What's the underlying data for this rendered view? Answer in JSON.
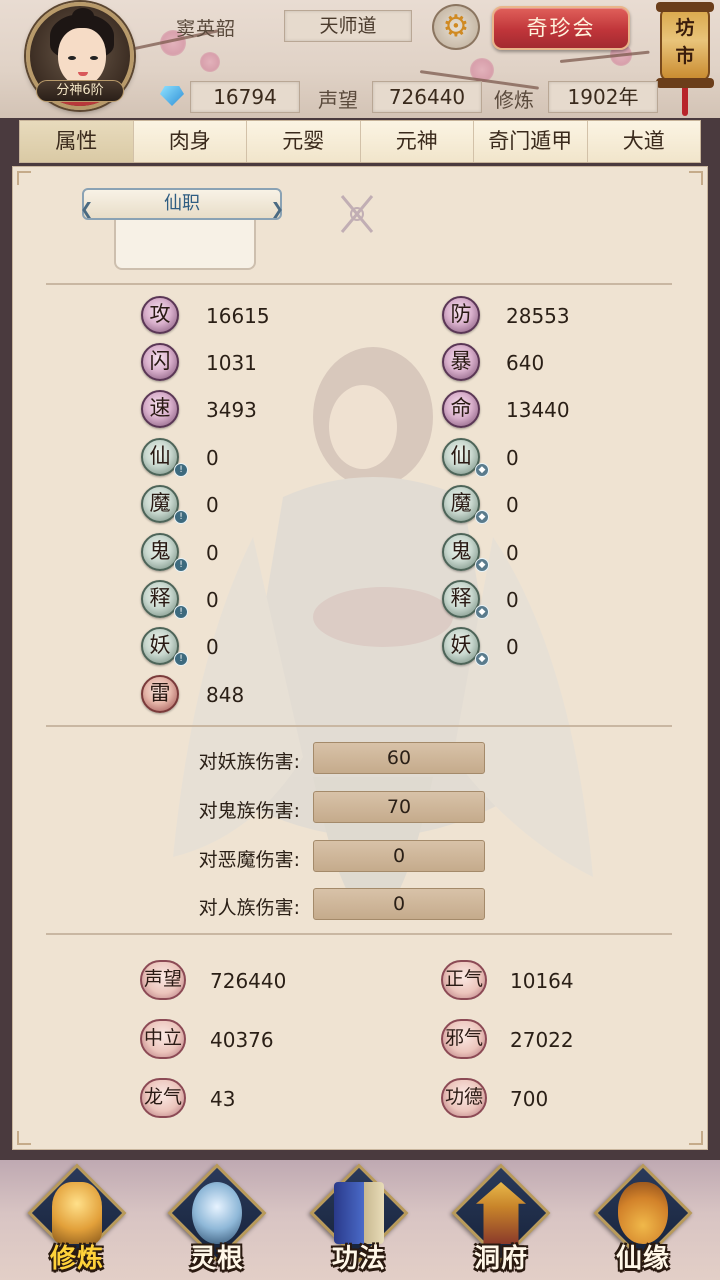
{
  "header": {
    "rank_badge": "分神6阶",
    "player_name": "窦英韶",
    "sect": "天师道",
    "treasure_button": "奇珍会",
    "market_label": "坊市",
    "gems": "16794",
    "reputation_label": "声望",
    "reputation": "726440",
    "cultivation_label": "修炼",
    "cultivation_years": "1902年"
  },
  "tabs": [
    {
      "label": "属性",
      "active": true
    },
    {
      "label": "肉身",
      "active": false
    },
    {
      "label": "元婴",
      "active": false
    },
    {
      "label": "元神",
      "active": false
    },
    {
      "label": "奇门遁甲",
      "active": false
    },
    {
      "label": "大道",
      "active": false
    }
  ],
  "immortal_post": {
    "label": "仙职"
  },
  "attributes": {
    "left": [
      {
        "icon": "攻",
        "value": "16615",
        "style": "purple",
        "badge": ""
      },
      {
        "icon": "闪",
        "value": "1031",
        "style": "purple",
        "badge": ""
      },
      {
        "icon": "速",
        "value": "3493",
        "style": "purple",
        "badge": ""
      },
      {
        "icon": "仙",
        "value": "0",
        "style": "teal",
        "badge": "attack"
      },
      {
        "icon": "魔",
        "value": "0",
        "style": "teal",
        "badge": "attack"
      },
      {
        "icon": "鬼",
        "value": "0",
        "style": "teal",
        "badge": "attack"
      },
      {
        "icon": "释",
        "value": "0",
        "style": "teal",
        "badge": "attack"
      },
      {
        "icon": "妖",
        "value": "0",
        "style": "teal",
        "badge": "attack"
      },
      {
        "icon": "雷",
        "value": "848",
        "style": "red",
        "badge": ""
      }
    ],
    "right": [
      {
        "icon": "防",
        "value": "28553",
        "style": "purple",
        "badge": ""
      },
      {
        "icon": "暴",
        "value": "640",
        "style": "purple",
        "badge": ""
      },
      {
        "icon": "命",
        "value": "13440",
        "style": "purple",
        "badge": ""
      },
      {
        "icon": "仙",
        "value": "0",
        "style": "teal",
        "badge": "defense"
      },
      {
        "icon": "魔",
        "value": "0",
        "style": "teal",
        "badge": "defense"
      },
      {
        "icon": "鬼",
        "value": "0",
        "style": "teal",
        "badge": "defense"
      },
      {
        "icon": "释",
        "value": "0",
        "style": "teal",
        "badge": "defense"
      },
      {
        "icon": "妖",
        "value": "0",
        "style": "teal",
        "badge": "defense"
      }
    ]
  },
  "damage_bonuses": [
    {
      "label": "对妖族伤害:",
      "value": "60"
    },
    {
      "label": "对鬼族伤害:",
      "value": "70"
    },
    {
      "label": "对恶魔伤害:",
      "value": "0"
    },
    {
      "label": "对人族伤害:",
      "value": "0"
    }
  ],
  "standing": {
    "left": [
      {
        "icon": "声望",
        "value": "726440"
      },
      {
        "icon": "中立",
        "value": "40376"
      },
      {
        "icon": "龙气",
        "value": "43"
      }
    ],
    "right": [
      {
        "icon": "正气",
        "value": "10164"
      },
      {
        "icon": "邪气",
        "value": "27022"
      },
      {
        "icon": "功德",
        "value": "700"
      }
    ]
  },
  "bottom_nav": [
    {
      "label": "修炼",
      "icon": "cultivation-icon",
      "active": true
    },
    {
      "label": "灵根",
      "icon": "spirit-root-icon",
      "active": false
    },
    {
      "label": "功法",
      "icon": "technique-book-icon",
      "active": false
    },
    {
      "label": "洞府",
      "icon": "cave-dwelling-icon",
      "active": false
    },
    {
      "label": "仙缘",
      "icon": "gourd-icon",
      "active": false
    }
  ],
  "colors": {
    "accent_red": "#c0353a",
    "active_nav": "#ffd23a",
    "panel_bg": "#efe3d2"
  }
}
